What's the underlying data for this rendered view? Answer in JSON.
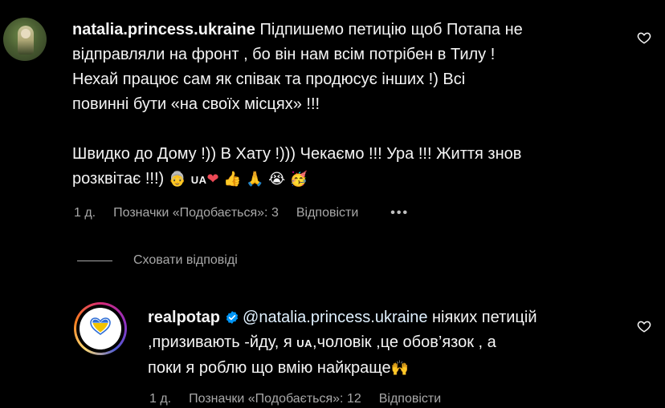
{
  "comment": {
    "username": "natalia.princess.ukraine",
    "text_line1": "Підпишемо петицію щоб Потапа не",
    "text_line2": "відправляли на фронт , бо він нам всім потрібен в Тилу !",
    "text_line3": "Нехай працює сам як співак та продюсує інших !) Всі",
    "text_line4": "повинні бути «на своїх місцях» !!!",
    "text_line5": "Швидко до Дому !)) В Хату !))) Чекаємо !!! Ура !!! Життя знов",
    "text_line6_start": "розквітає !!!)",
    "emoji_1": "👵",
    "ua_flag": "UA",
    "emoji_heart": "❤",
    "emoji_2": "👍",
    "emoji_3": "🙏",
    "emoji_4": "😭",
    "emoji_5": "🥳",
    "time": "1 д.",
    "likes": "Позначки «Подобається»: 3",
    "reply_label": "Відповісти",
    "more_label": "•••"
  },
  "replies_toggle": {
    "label": "Сховати відповіді"
  },
  "reply": {
    "username": "realpotap",
    "mention": "@natalia.princess.ukraine",
    "text_line1_rest": " ніяких петицій",
    "text_line2_a": ",призивають -йду, я",
    "ua_flag": "UA",
    "text_line2_b": ",чоловік ,це обов’язок , а",
    "text_line3": "поки я роблю що вмію найкраще",
    "emoji_end": "🙌",
    "time": "1 д.",
    "likes": "Позначки «Подобається»: 12",
    "reply_label": "Відповісти"
  },
  "colors": {
    "background": "#000000",
    "text": "#f5f5f5",
    "secondary": "#a8a8a8",
    "verified": "#0095f6",
    "heart": "#ed4956"
  }
}
